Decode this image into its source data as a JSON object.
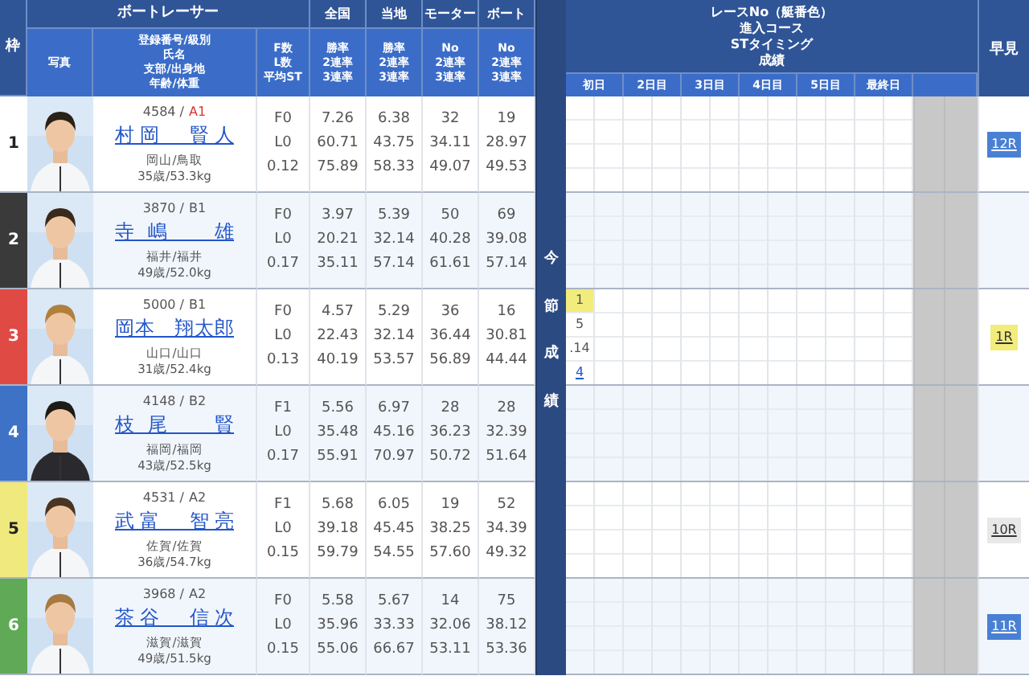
{
  "header": {
    "frame": "枠",
    "racer": "ボートレーサー",
    "groups": [
      "全国",
      "当地",
      "モーター",
      "ボート"
    ],
    "photo": "写真",
    "sub": [
      [
        "登録番号/級別",
        "氏名",
        "支部/出身地",
        "年齢/体重"
      ],
      [
        "F数",
        "L数",
        "平均ST"
      ],
      [
        "勝率",
        "2連率",
        "3連率"
      ],
      [
        "勝率",
        "2連率",
        "3連率"
      ],
      [
        "No",
        "2連率",
        "3連率"
      ],
      [
        "No",
        "2連率",
        "3連率"
      ]
    ],
    "divider": "今節成績",
    "series": [
      "レースNo（艇番色）",
      "進入コース",
      "STタイミング",
      "成績"
    ],
    "days": [
      "初日",
      "2日目",
      "3日目",
      "4日目",
      "5日目",
      "最終日"
    ],
    "hayami": "早見"
  },
  "racers": [
    {
      "frame": "1",
      "color": "#ffffff",
      "reg": "4584 /",
      "grade": "A1",
      "grade_emphasis": true,
      "name": "村岡　賢人",
      "home": "岡山/鳥取",
      "body": "35歳/53.3kg",
      "stats": [
        [
          "F0",
          "L0",
          "0.12"
        ],
        [
          "7.26",
          "60.71",
          "75.89"
        ],
        [
          "6.38",
          "43.75",
          "58.33"
        ],
        [
          "32",
          "34.11",
          "49.07"
        ],
        [
          "19",
          "28.97",
          "49.53"
        ]
      ],
      "hayami": {
        "label": "12R",
        "color": "#4a80d4"
      }
    },
    {
      "frame": "2",
      "color": "#3a3a3a",
      "reg": "3870 /",
      "grade": "B1",
      "grade_emphasis": false,
      "name": "寺嶋　雄",
      "home": "福井/福井",
      "body": "49歳/52.0kg",
      "stats": [
        [
          "F0",
          "L0",
          "0.17"
        ],
        [
          "3.97",
          "20.21",
          "35.11"
        ],
        [
          "5.39",
          "32.14",
          "57.14"
        ],
        [
          "50",
          "40.28",
          "61.61"
        ],
        [
          "69",
          "39.08",
          "57.14"
        ]
      ]
    },
    {
      "frame": "3",
      "color": "#e04a44",
      "reg": "5000 /",
      "grade": "B1",
      "grade_emphasis": false,
      "name": "岡本　翔太郎",
      "home": "山口/山口",
      "body": "31歳/52.4kg",
      "stats": [
        [
          "F0",
          "L0",
          "0.13"
        ],
        [
          "4.57",
          "22.43",
          "40.19"
        ],
        [
          "5.29",
          "32.14",
          "53.57"
        ],
        [
          "36",
          "36.44",
          "56.89"
        ],
        [
          "16",
          "30.81",
          "44.44"
        ]
      ],
      "races": [
        {
          "race_no": "1",
          "color": "#f2ec7c",
          "course": "5",
          "st": ".14",
          "result": "4"
        }
      ],
      "hayami": {
        "label": "1R",
        "color": "#f2ec7c"
      }
    },
    {
      "frame": "4",
      "color": "#3d72c6",
      "reg": "4148 /",
      "grade": "B2",
      "grade_emphasis": false,
      "name": "枝尾　賢",
      "home": "福岡/福岡",
      "body": "43歳/52.5kg",
      "stats": [
        [
          "F1",
          "L0",
          "0.17"
        ],
        [
          "5.56",
          "35.48",
          "55.91"
        ],
        [
          "6.97",
          "45.16",
          "70.97"
        ],
        [
          "28",
          "36.23",
          "50.72"
        ],
        [
          "28",
          "32.39",
          "51.64"
        ]
      ]
    },
    {
      "frame": "5",
      "color": "#f0ea7e",
      "reg": "4531 /",
      "grade": "A2",
      "grade_emphasis": false,
      "name": "武富　智亮",
      "home": "佐賀/佐賀",
      "body": "36歳/54.7kg",
      "stats": [
        [
          "F1",
          "L0",
          "0.15"
        ],
        [
          "5.68",
          "39.18",
          "59.79"
        ],
        [
          "6.05",
          "45.45",
          "54.55"
        ],
        [
          "19",
          "38.25",
          "57.60"
        ],
        [
          "52",
          "34.39",
          "49.32"
        ]
      ],
      "hayami": {
        "label": "10R",
        "color": "#e8e8e8"
      }
    },
    {
      "frame": "6",
      "color": "#5fa957",
      "reg": "3968 /",
      "grade": "A2",
      "grade_emphasis": false,
      "name": "茶谷　信次",
      "home": "滋賀/滋賀",
      "body": "49歳/51.5kg",
      "stats": [
        [
          "F0",
          "L0",
          "0.15"
        ],
        [
          "5.58",
          "35.96",
          "55.06"
        ],
        [
          "5.67",
          "33.33",
          "66.67"
        ],
        [
          "14",
          "32.06",
          "53.11"
        ],
        [
          "75",
          "38.12",
          "53.36"
        ]
      ],
      "hayami": {
        "label": "11R",
        "color": "#4a80d4"
      }
    }
  ]
}
